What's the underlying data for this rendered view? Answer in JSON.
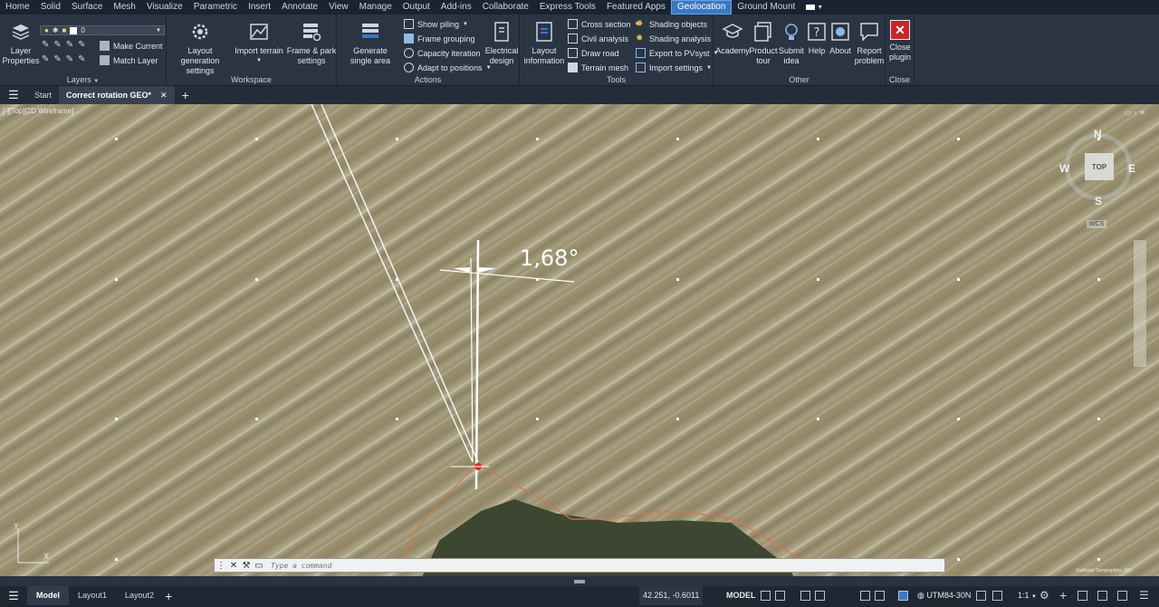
{
  "menu": {
    "tabs": [
      "Home",
      "Solid",
      "Surface",
      "Mesh",
      "Visualize",
      "Parametric",
      "Insert",
      "Annotate",
      "View",
      "Manage",
      "Output",
      "Add-ins",
      "Collaborate",
      "Express Tools",
      "Featured Apps",
      "Geolocation",
      "Ground Mount"
    ],
    "active": "Geolocation"
  },
  "ribbon": {
    "layers": {
      "title": "Layers",
      "layer_properties": "Layer Properties",
      "current_layer": "0",
      "make_current": "Make Current",
      "match_layer": "Match Layer"
    },
    "workspace": {
      "title": "Workspace",
      "layout_generation": "Layout generation settings",
      "import_terrain": "Import terrain",
      "frame_park": "Frame & park settings"
    },
    "actions": {
      "title": "Actions",
      "generate_single": "Generate single area",
      "show_piling": "Show piling",
      "frame_grouping": "Frame grouping",
      "capacity_iteration": "Capacity iteration",
      "adapt_positions": "Adapt to positions",
      "electrical_design": "Electrical design"
    },
    "tools": {
      "title": "Tools",
      "layout_information": "Layout information",
      "cross_section": "Cross section",
      "civil_analysis": "Civil analysis",
      "draw_road": "Draw road",
      "terrain_mesh": "Terrain mesh",
      "shading_objects": "Shading objects",
      "shading_analysis": "Shading analysis",
      "export_pvsyst": "Export to PVsyst",
      "import_settings": "Import settings"
    },
    "other": {
      "title": "Other",
      "academy": "Academy",
      "product_tour": "Product tour",
      "submit_idea": "Submit idea",
      "help": "Help",
      "about": "About",
      "report_problem": "Report problem"
    },
    "close": {
      "title": "Close",
      "close_plugin": "Close plugin"
    }
  },
  "file_tabs": {
    "start": "Start",
    "active": "Correct rotation GEO*"
  },
  "viewport": {
    "label": "[-][Top][2D Wireframe]",
    "angle_text": "1,68°",
    "compass": {
      "n": "N",
      "s": "S",
      "e": "E",
      "w": "W",
      "cube": "TOP",
      "wcs": "WCS"
    },
    "attribution": "Earthstar Geographics, SIO"
  },
  "command": {
    "placeholder": "Type a command"
  },
  "status": {
    "model_tab": "Model",
    "layout1": "Layout1",
    "layout2": "Layout2",
    "coords": "42.251, -0.6011",
    "space": "MODEL",
    "crs": "UTM84-30N",
    "scale": "1:1"
  },
  "colors": {
    "accent": "#3a78c4",
    "close_red": "#c8242c",
    "ribbon_bg": "#2b3442"
  }
}
